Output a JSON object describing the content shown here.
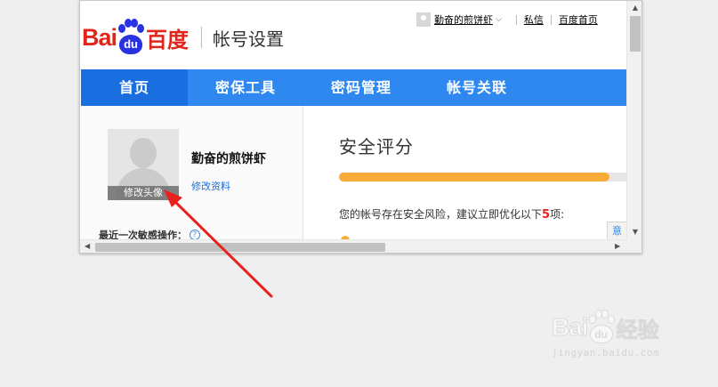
{
  "header": {
    "logo_text": "Bai",
    "logo_paw_text": "du",
    "logo_cn": "百度",
    "page_name": "帐号设置",
    "user_name": "勤奋的煎饼虾",
    "messages_link": "私信",
    "home_link": "百度首页"
  },
  "nav": {
    "items": [
      {
        "label": "首页",
        "active": true
      },
      {
        "label": "密保工具",
        "active": false
      },
      {
        "label": "密码管理",
        "active": false
      },
      {
        "label": "帐号关联",
        "active": false
      }
    ]
  },
  "profile": {
    "avatar_button": "修改头像",
    "nickname": "勤奋的煎饼虾",
    "edit_profile_link": "修改资料",
    "last_operation_label": "最近一次敏感操作：",
    "help_icon_glyph": "?"
  },
  "security": {
    "title": "安全评分",
    "score_fraction": 0.94,
    "risk_text_prefix": "您的帐号存在安全风险，建议立即优化以下",
    "risk_count": "5",
    "risk_text_suffix": "项:",
    "side_tab_glyph": "意"
  },
  "watermark": {
    "logo_text": "Bai",
    "paw_text": "du",
    "cn_text": "经验",
    "url": "jingyan.baidu.com"
  },
  "colors": {
    "nav_blue": "#2f88f0",
    "nav_active": "#1a6fe0",
    "brand_red": "#e1251b",
    "brand_blue": "#2932e1",
    "score_orange": "#f7ac3a",
    "arrow_red": "#e8201e"
  }
}
